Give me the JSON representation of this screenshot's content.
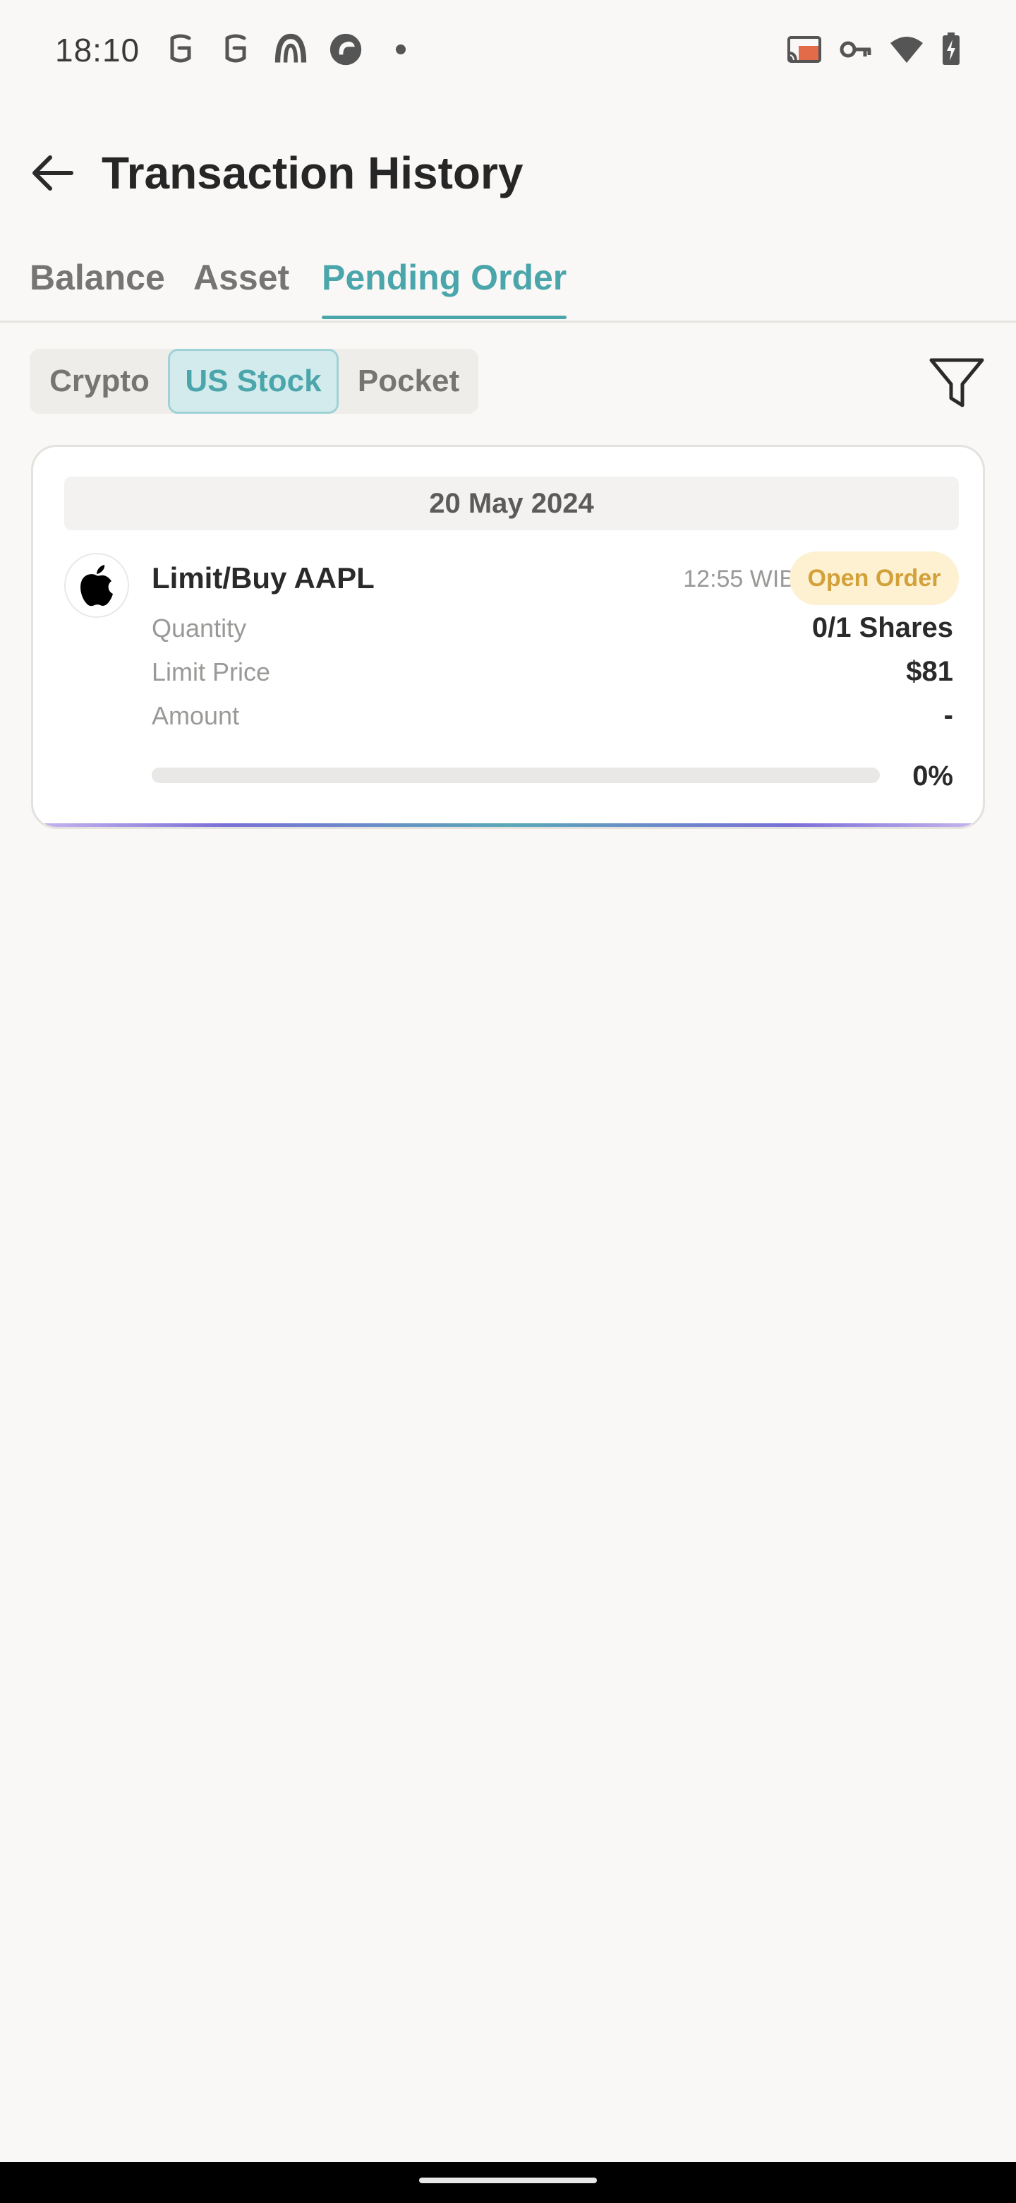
{
  "status_bar": {
    "time": "18:10",
    "left_icons": [
      "notification-s-icon",
      "notification-s-icon",
      "app-arc-icon",
      "app-circle-icon",
      "dot-icon"
    ],
    "right_icons": [
      "cast-icon",
      "vpn-key-icon",
      "wifi-icon",
      "battery-charging-icon"
    ]
  },
  "header": {
    "title": "Transaction History",
    "back_icon": "arrow-left-icon"
  },
  "main_tabs": [
    {
      "label": "Balance",
      "active": false
    },
    {
      "label": "Asset",
      "active": false
    },
    {
      "label": "Pending Order",
      "active": true
    }
  ],
  "asset_filter": {
    "segments": [
      {
        "label": "Crypto",
        "active": false
      },
      {
        "label": "US Stock",
        "active": true
      },
      {
        "label": "Pocket",
        "active": false
      }
    ],
    "filter_icon": "filter-funnel-icon"
  },
  "orders": [
    {
      "date": "20 May 2024",
      "title": "Limit/Buy AAPL",
      "time": "12:55 WIB",
      "status": "Open Order",
      "logo_icon": "apple-logo-icon",
      "details": [
        {
          "label": "Quantity",
          "value": "0/1 Shares"
        },
        {
          "label": "Limit Price",
          "value": "$81"
        },
        {
          "label": "Amount",
          "value": "-"
        }
      ],
      "progress_percent": 0,
      "progress_label": "0%"
    }
  ],
  "colors": {
    "accent": "#4ba6ac",
    "background": "#f9f8f6",
    "badge_bg": "#fdf1d2",
    "badge_text": "#d3a13a"
  }
}
